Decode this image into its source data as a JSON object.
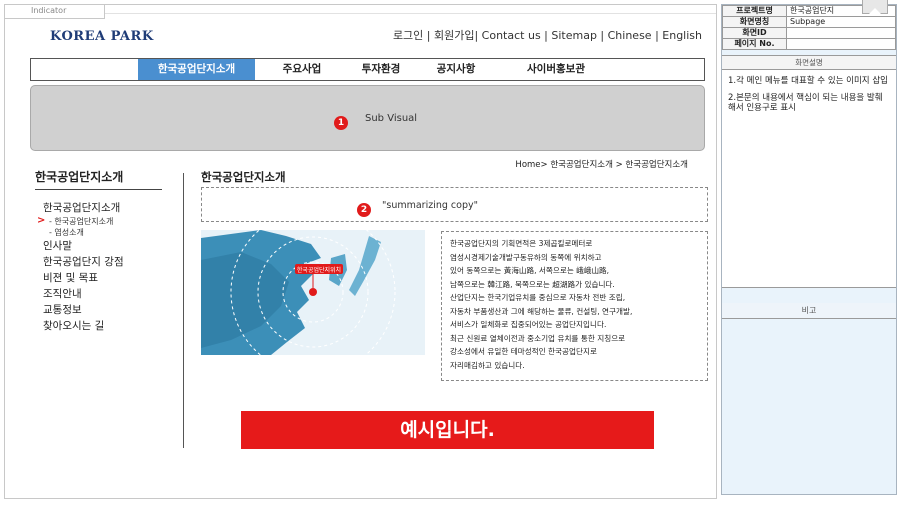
{
  "indicator": "Indicator",
  "logo": "KOREA PARK",
  "util_nav": "로그인 | 회원가입| Contact us | Sitemap | Chinese | English",
  "gnb": [
    "한국공업단지소개",
    "주요사업",
    "투자환경",
    "공지사항",
    "사이버홍보관"
  ],
  "sub_visual": {
    "badge": "1",
    "label": "Sub Visual"
  },
  "lnb": {
    "title": "한국공업단지소개",
    "items": [
      {
        "label": "한국공업단지소개",
        "sub": [
          "- 한국공업단지소개",
          "- 염성소개"
        ]
      },
      {
        "label": "인사말"
      },
      {
        "label": "한국공업단지 강점"
      },
      {
        "label": "비젼 및 목표"
      },
      {
        "label": "조직안내"
      },
      {
        "label": "교통정보"
      },
      {
        "label": "찾아오시는 길"
      }
    ],
    "current_marker": ">"
  },
  "content": {
    "title": "한국공업단지소개",
    "breadcrumb": "Home> 한국공업단지소개 > 한국공업단지소개",
    "summary_badge": "2",
    "summary": "\"summarizing copy\"",
    "map_label": "한국공업단지위치",
    "paragraph": [
      "한국공업단지의 기획면적은 3제곱킬로메터로",
      "염성시경제기술개발구동유하의 동쪽에 위치하고",
      "있어 동쪽으로는 黃海山路, 서쪽으로는 峨峨山路,",
      "남쪽으로는 韓江路, 북쪽으로는 超湖路가 있습니다.",
      "산업단지는 한국기업유치를 중심으로 자동차 전반 조립,",
      "자동차 부품생산과 그에 해당하는 물류, 컨설팅, 연구개발,",
      "서비스가 일체화로 집중되어있는 공업단지입니다.",
      "최근 신원료 열체이전과 중소기업 유치를 통한 지칭으로",
      "강소성에서 유일한 테마성적인 한국공업단지로",
      "자리매김하고 있습니다."
    ],
    "banner": "예시입니다."
  },
  "spec": {
    "rows": [
      {
        "key": "프로젝트명",
        "value": "한국공업단지"
      },
      {
        "key": "화면명칭",
        "value": "Subpage"
      },
      {
        "key": "화면ID",
        "value": ""
      },
      {
        "key": "페이지 No.",
        "value": ""
      }
    ],
    "desc_header": "화면설명",
    "desc_items": [
      "1.각 메인 메뉴를 대표할 수 있는 이미지 삽입",
      "2.본문의 내용에서 핵심이 되는 내용을 발췌해서 인용구로 표시"
    ],
    "note_header": "비고"
  },
  "colors": {
    "accent_blue": "#4a8fd0",
    "badge_red": "#e11b1b",
    "banner_red": "#e61a1a",
    "logo_navy": "#1f3c77",
    "panel_blue": "#e9f3fb"
  }
}
